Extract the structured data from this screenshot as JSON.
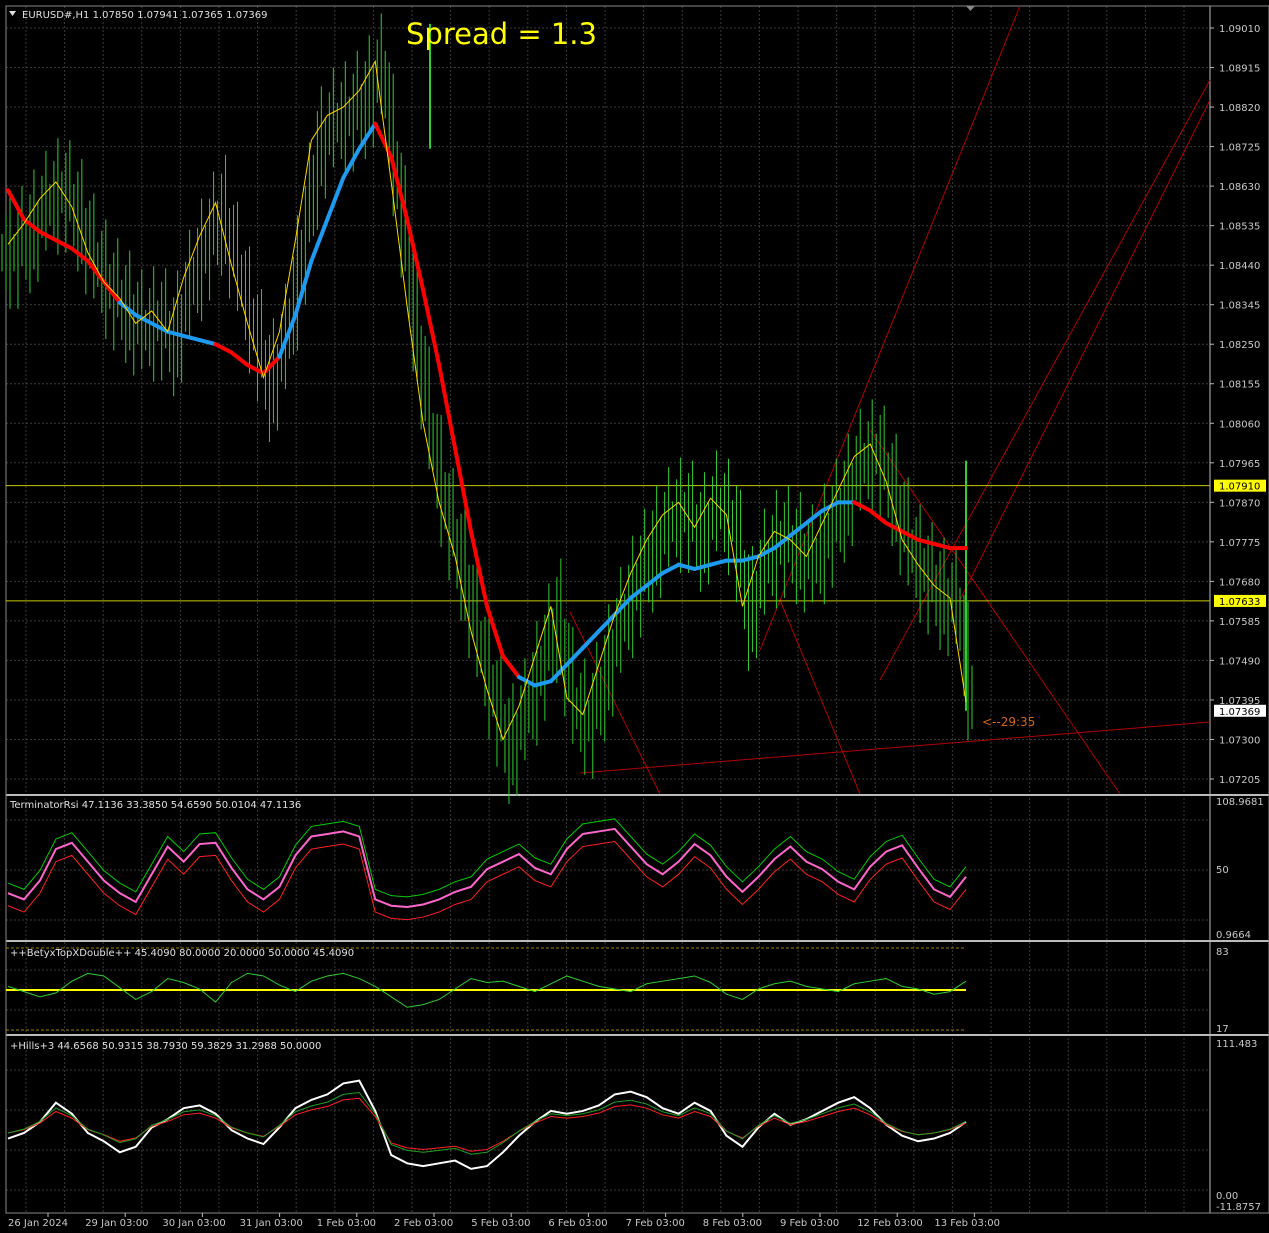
{
  "window": {
    "symbol_header": "EURUSD#,H1  1.07850 1.07941 1.07365 1.07369",
    "spread_label": "Spread = 1.3",
    "countdown": "<--29:35"
  },
  "colors": {
    "background": "#000000",
    "grid": "#3a3a3a",
    "candle": "#32cd32",
    "price_line": "#c8c800",
    "ma_red": "#ff0000",
    "ma_blue": "#1e9bf0",
    "axis_text": "#c8c8c8",
    "spread_text": "#ffff00"
  },
  "chart_data": [
    {
      "type": "candlestick",
      "panel": "main",
      "y_ticks": [
        "1.09010",
        "1.08915",
        "1.08820",
        "1.08725",
        "1.08630",
        "1.08535",
        "1.08440",
        "1.08345",
        "1.08250",
        "1.08155",
        "1.08060",
        "1.07965",
        "1.07870",
        "1.07775",
        "1.07680",
        "1.07585",
        "1.07490",
        "1.07395",
        "1.07300",
        "1.07205"
      ],
      "ylim": [
        1.0715,
        1.0908
      ],
      "horizontal_lines": [
        {
          "label": "1.07910",
          "value": 1.0791
        },
        {
          "label": "1.07633",
          "value": 1.07633
        }
      ],
      "current_price": {
        "label": "1.07369",
        "value": 1.07369
      },
      "series": [
        {
          "name": "close",
          "values": [
            1.0847,
            1.0852,
            1.0858,
            1.0862,
            1.0856,
            1.0845,
            1.0838,
            1.0834,
            1.0828,
            1.0831,
            1.0826,
            1.0839,
            1.0849,
            1.0857,
            1.0842,
            1.0828,
            1.0815,
            1.0826,
            1.0848,
            1.0872,
            1.0878,
            1.088,
            1.0884,
            1.0891,
            1.0862,
            1.0832,
            1.0804,
            1.0785,
            1.0772,
            1.0754,
            1.074,
            1.0728,
            1.0736,
            1.0748,
            1.076,
            1.0738,
            1.0734,
            1.0746,
            1.0758,
            1.0768,
            1.0776,
            1.0782,
            1.0785,
            1.0779,
            1.0786,
            1.0782,
            1.076,
            1.0772,
            1.0778,
            1.0776,
            1.0772,
            1.078,
            1.0788,
            1.0796,
            1.0799,
            1.079,
            1.0776,
            1.077,
            1.0765,
            1.0762,
            1.0737
          ]
        },
        {
          "name": "ma_slow",
          "values": [
            1.0862,
            1.0855,
            1.0852,
            1.085,
            1.0848,
            1.0845,
            1.084,
            1.0835,
            1.0832,
            1.083,
            1.0828,
            1.0827,
            1.0826,
            1.0825,
            1.0823,
            1.082,
            1.0818,
            1.0822,
            1.0832,
            1.0845,
            1.0855,
            1.0865,
            1.0872,
            1.0878,
            1.087,
            1.0855,
            1.0838,
            1.082,
            1.08,
            1.078,
            1.0762,
            1.075,
            1.0745,
            1.0743,
            1.0744,
            1.0748,
            1.0752,
            1.0756,
            1.076,
            1.0764,
            1.0767,
            1.077,
            1.0772,
            1.0771,
            1.0772,
            1.0773,
            1.0773,
            1.0774,
            1.0776,
            1.0779,
            1.0782,
            1.0785,
            1.0787,
            1.0787,
            1.0785,
            1.0782,
            1.078,
            1.0778,
            1.0777,
            1.0776,
            1.0776
          ]
        }
      ]
    },
    {
      "type": "line",
      "panel": "TerminatorRsi",
      "title": "TerminatorRsi 47.1136 33.3850 54.6590 50.0104 47.1136",
      "y_ticks": [
        "108.9681",
        "50",
        "0.9664"
      ],
      "ylim": [
        0.9664,
        108.9681
      ],
      "series": [
        {
          "name": "rsi",
          "values": [
            35,
            30,
            45,
            70,
            75,
            60,
            45,
            35,
            28,
            50,
            72,
            60,
            74,
            75,
            55,
            38,
            30,
            40,
            65,
            80,
            82,
            84,
            80,
            30,
            25,
            24,
            26,
            30,
            36,
            40,
            54,
            60,
            66,
            55,
            50,
            70,
            82,
            84,
            86,
            72,
            58,
            50,
            60,
            74,
            65,
            48,
            36,
            48,
            62,
            72,
            60,
            54,
            44,
            38,
            56,
            68,
            73,
            55,
            38,
            32,
            48
          ]
        }
      ]
    },
    {
      "type": "line",
      "panel": "BetyxTopXDouble",
      "title": "++BetyxTopXDouble++ 45.4090 80.0000 20.0000 50.0000 45.4090",
      "y_ticks": [
        "83",
        "17"
      ],
      "ylim": [
        17,
        83
      ],
      "series": [
        {
          "name": "osc",
          "values": [
            52,
            48,
            44,
            47,
            56,
            62,
            60,
            51,
            42,
            48,
            58,
            55,
            50,
            40,
            55,
            62,
            60,
            53,
            48,
            56,
            60,
            62,
            58,
            52,
            44,
            36,
            38,
            42,
            50,
            58,
            55,
            56,
            52,
            48,
            54,
            60,
            56,
            52,
            50,
            48,
            54,
            56,
            58,
            60,
            55,
            46,
            42,
            50,
            54,
            56,
            52,
            50,
            48,
            54,
            56,
            58,
            52,
            50,
            46,
            48,
            56
          ]
        }
      ]
    },
    {
      "type": "line",
      "panel": "Hills",
      "title": "+Hills+3 44.6568 50.9315 38.7930 59.3829 31.2988 50.0000",
      "y_ticks": [
        "111.483",
        "0.00",
        "-11.8757"
      ],
      "ylim": [
        -11.8757,
        111.483
      ],
      "series": [
        {
          "name": "hills",
          "values": [
            40,
            44,
            52,
            66,
            58,
            44,
            38,
            30,
            34,
            48,
            54,
            62,
            64,
            58,
            46,
            40,
            36,
            48,
            62,
            68,
            72,
            80,
            82,
            60,
            28,
            22,
            20,
            22,
            24,
            18,
            20,
            30,
            42,
            52,
            60,
            58,
            60,
            64,
            72,
            74,
            70,
            62,
            58,
            66,
            60,
            42,
            34,
            48,
            58,
            50,
            54,
            60,
            66,
            70,
            62,
            50,
            42,
            38,
            40,
            44,
            52
          ]
        }
      ]
    }
  ],
  "time_axis": {
    "labels": [
      "26 Jan 2024",
      "29 Jan 03:00",
      "30 Jan 03:00",
      "31 Jan 03:00",
      "1 Feb 03:00",
      "2 Feb 03:00",
      "5 Feb 03:00",
      "6 Feb 03:00",
      "7 Feb 03:00",
      "8 Feb 03:00",
      "9 Feb 03:00",
      "12 Feb 03:00",
      "13 Feb 03:00"
    ]
  }
}
